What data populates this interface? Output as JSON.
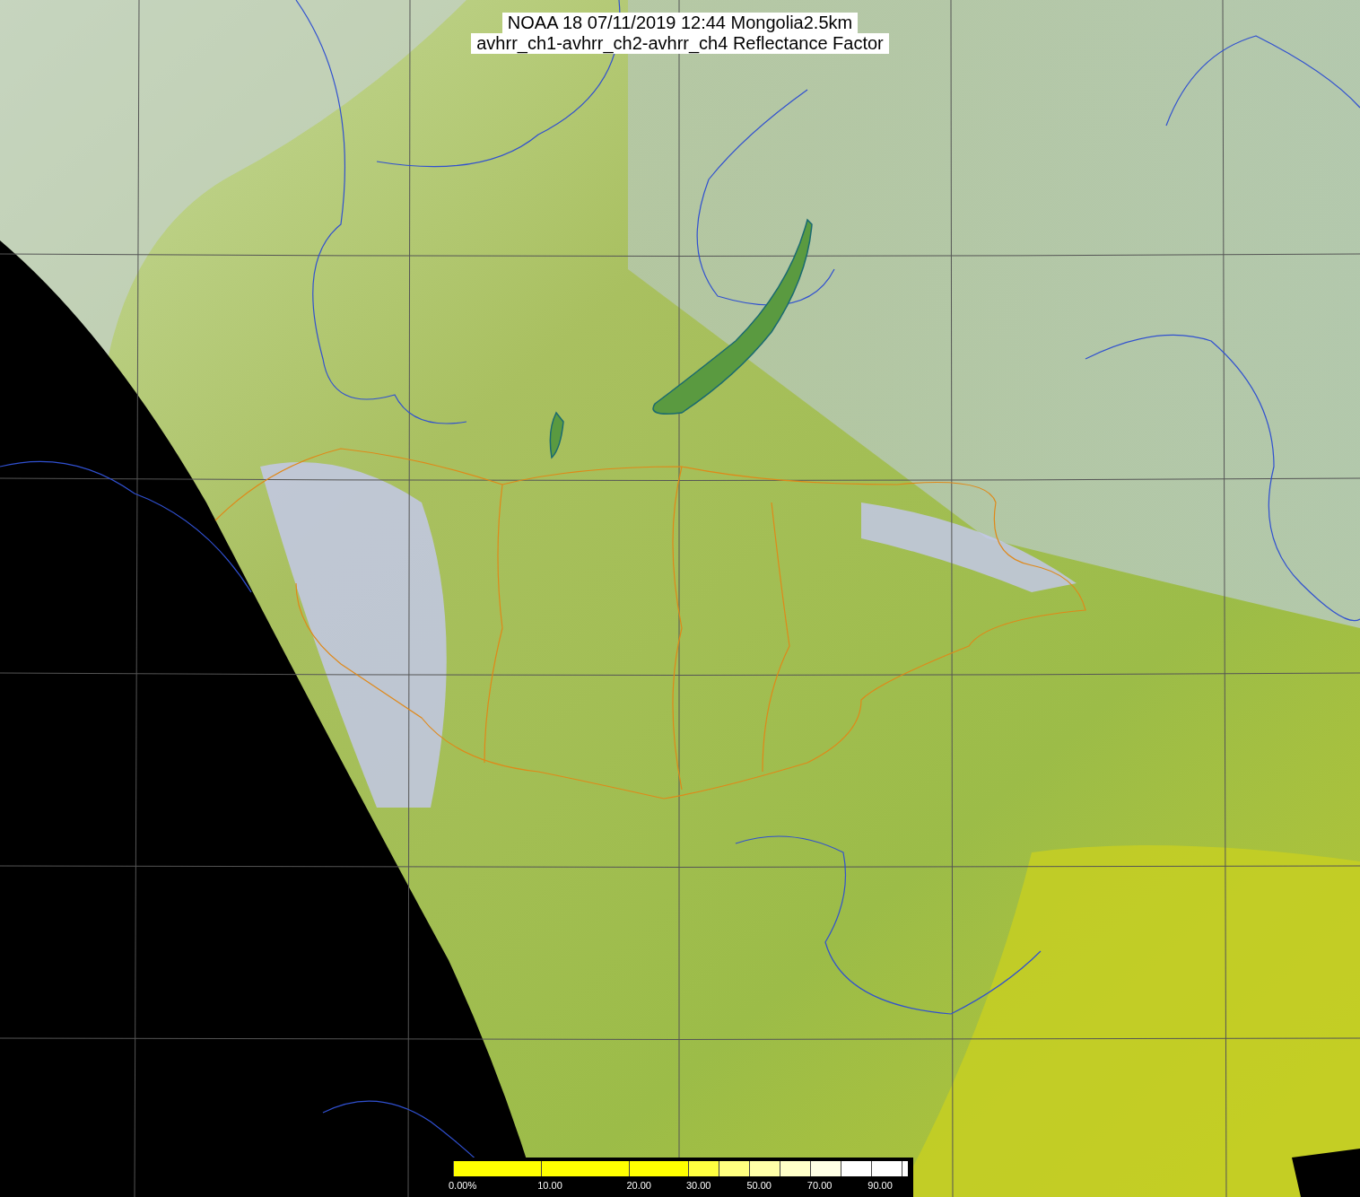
{
  "title": {
    "lines": [
      "NOAA 18 07/11/2019 12:44 Mongolia2.5km",
      "avhrr_ch1-avhrr_ch2-avhrr_ch4 Reflectance Factor"
    ]
  },
  "legend": {
    "segments": [
      {
        "color": "#ffff00",
        "label": "0.00%"
      },
      {
        "color": "#ffff00",
        "label": "10.00"
      },
      {
        "color": "#ffff00",
        "label": "20.00"
      },
      {
        "color": "#ffff40",
        "label": "30.00"
      },
      {
        "color": "#ffff80"
      },
      {
        "color": "#ffffa8",
        "label": "50.00"
      },
      {
        "color": "#ffffc8"
      },
      {
        "color": "#ffffe4",
        "label": "70.00"
      },
      {
        "color": "#ffffff"
      },
      {
        "color": "#ffffff",
        "label": "90.00"
      },
      {
        "color": "#ffffff"
      }
    ]
  }
}
